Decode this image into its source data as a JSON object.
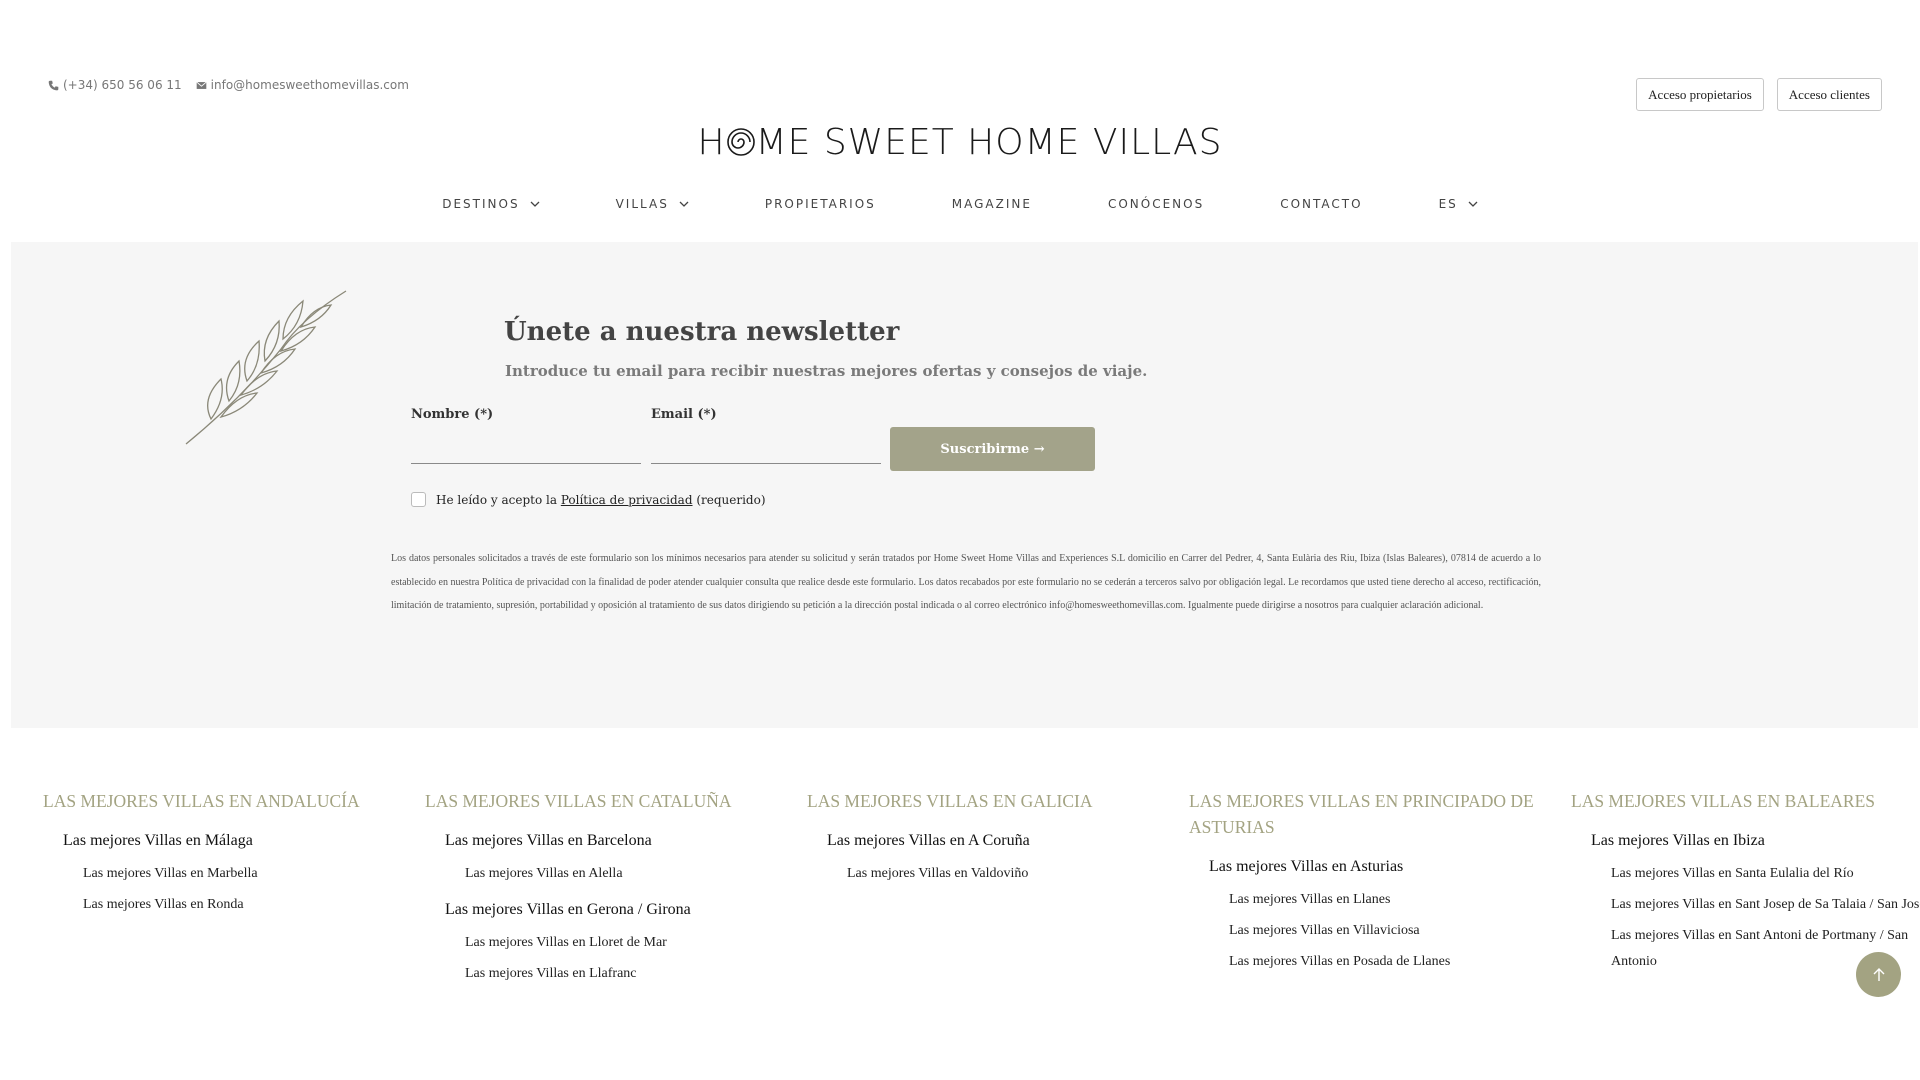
{
  "contact": {
    "phone": "(+34) 650 56 06 11",
    "email": "info@homesweethomevillas.com"
  },
  "account": {
    "owners_label": "Acceso propietarios",
    "clients_label": "Acceso clientes"
  },
  "logo": {
    "part1": "H",
    "part2": "ME SWEET HOME VILLAS"
  },
  "nav": {
    "items": [
      {
        "label": "DESTINOS"
      },
      {
        "label": "VILLAS"
      },
      {
        "label": "PROPIETARIOS"
      },
      {
        "label": "MAGAZINE"
      },
      {
        "label": "CONÓCENOS"
      },
      {
        "label": "CONTACTO"
      },
      {
        "label": "ES"
      }
    ]
  },
  "newsletter": {
    "title": "Únete a nuestra newsletter",
    "subtitle": "Introduce tu email para recibir nuestras mejores ofertas y consejos de viaje.",
    "name_label": "Nombre (*)",
    "email_label": "Email (*)",
    "button_label": "Suscribirme →",
    "consent_prefix": "He leído y acepto la ",
    "consent_link": "Política de privacidad",
    "consent_suffix": " (requerido)",
    "legal": "Los datos personales solicitados a través de este formulario son los mínimos necesarios para atender su solicitud y serán tratados por Home Sweet Home Villas and Experiences S.L domicilio en Carrer del Pedrer, 4, Santa Eulària des Riu, Ibiza (Islas Baleares), 07814 de acuerdo a lo establecido en nuestra Política de privacidad con la finalidad de poder atender cualquier consulta que realice desde este formulario. Los datos recabados por este formulario no se cederán a terceros salvo por obligación legal. Le recordamos que usted tiene derecho al acceso, rectificación, limitación de tratamiento, supresión, portabilidad y oposición al tratamiento de sus datos dirigiendo su petición a la dirección postal indicada o al correo electrónico info@homesweethomevillas.com. Igualmente puede dirigirse a nosotros para cualquier aclaración adicional."
  },
  "footer": {
    "columns": [
      {
        "title": "LAS MEJORES VILLAS EN ANDALUCÍA",
        "groups": [
          {
            "city": "Las mejores Villas en Málaga",
            "subs": [
              "Las mejores Villas en Marbella",
              "Las mejores Villas en Ronda"
            ]
          }
        ]
      },
      {
        "title": "LAS MEJORES VILLAS EN CATALUÑA",
        "groups": [
          {
            "city": "Las mejores Villas en Barcelona",
            "subs": [
              "Las mejores Villas en Alella"
            ]
          },
          {
            "city": "Las mejores Villas en Gerona / Girona",
            "subs": [
              "Las mejores Villas en Lloret de Mar",
              "Las mejores Villas en Llafranc"
            ]
          }
        ]
      },
      {
        "title": "LAS MEJORES VILLAS EN GALICIA",
        "groups": [
          {
            "city": "Las mejores Villas en A Coruña",
            "subs": [
              "Las mejores Villas en Valdoviño"
            ]
          }
        ]
      },
      {
        "title": "LAS MEJORES VILLAS EN PRINCIPADO DE ASTURIAS",
        "groups": [
          {
            "city": "Las mejores Villas en Asturias",
            "subs": [
              "Las mejores Villas en Llanes",
              "Las mejores Villas en Villaviciosa",
              "Las mejores Villas en Posada de Llanes"
            ]
          }
        ]
      },
      {
        "title": "LAS MEJORES VILLAS EN BALEARES",
        "groups": [
          {
            "city": "Las mejores Villas en Ibiza",
            "subs": [
              "Las mejores Villas en Santa Eulalia del Río",
              "Las mejores Villas en Sant Josep de Sa Talaia / San Jose",
              "Las mejores Villas en Sant Antoni de Portmany / San Antonio"
            ]
          }
        ]
      }
    ]
  },
  "icons": {
    "phone": "phone-icon",
    "email": "envelope-icon",
    "back_to_top": "arrow-up-icon",
    "decoration": "olive-branch-icon"
  },
  "colors": {
    "accent": "#a3a38a",
    "footer_heading": "#a3a382",
    "newsletter_bg": "#f6f6f6"
  }
}
